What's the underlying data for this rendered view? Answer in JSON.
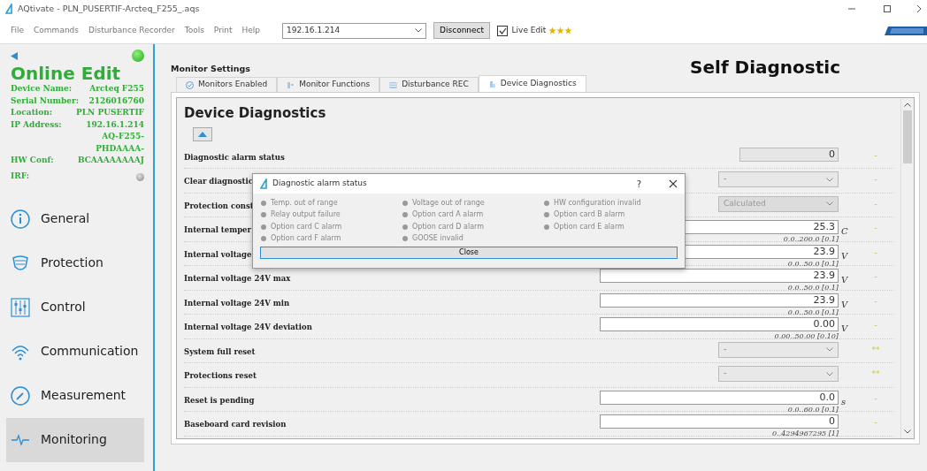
{
  "window": {
    "title": "AQtivate - PLN_PUSERTIF-Arcteq_F255_.aqs"
  },
  "menu": [
    "File",
    "Commands",
    "Disturbance Recorder",
    "Tools",
    "Print",
    "Help"
  ],
  "toolbar": {
    "address": "192.16.1.214",
    "disconnect": "Disconnect",
    "live_edit": {
      "label": "Live Edit",
      "checked": true
    },
    "stars": 3
  },
  "sidebar": {
    "online": true,
    "title": "Online Edit",
    "info": [
      {
        "label": "Device Name:",
        "value": "Arcteq F255"
      },
      {
        "label": "Serial Number:",
        "value": "2126016760"
      },
      {
        "label": "Location:",
        "value": "PLN PUSERTIF"
      },
      {
        "label": "IP Address:",
        "value": "192.16.1.214"
      },
      {
        "label": "HW Conf:",
        "value": "AQ-F255-PHDAAAA-BCAAAAAAAAJ"
      }
    ],
    "irf": {
      "label": "IRF:",
      "active": false
    },
    "items": [
      {
        "label": "General",
        "selected": false
      },
      {
        "label": "Protection",
        "selected": false
      },
      {
        "label": "Control",
        "selected": false
      },
      {
        "label": "Communication",
        "selected": false
      },
      {
        "label": "Measurement",
        "selected": false
      },
      {
        "label": "Monitoring",
        "selected": true
      }
    ]
  },
  "section": "Monitor Settings",
  "headline": "Self Diagnostic",
  "tabs": [
    {
      "label": "Monitors Enabled",
      "selected": false
    },
    {
      "label": "Monitor Functions",
      "selected": false
    },
    {
      "label": "Disturbance REC",
      "selected": false
    },
    {
      "label": "Device Diagnostics",
      "selected": true
    }
  ],
  "heading": "Device Diagnostics",
  "rows": [
    {
      "kind": "readonly",
      "label": "Diagnostic alarm status",
      "value": "0",
      "marker": "-"
    },
    {
      "kind": "select",
      "label": "Clear diagnostic",
      "value": "-",
      "marker": "-"
    },
    {
      "kind": "select_disabled",
      "label": "Protection const",
      "value": "Calculated",
      "marker": "-"
    },
    {
      "kind": "number",
      "label": "Internal temper",
      "value": "25.3",
      "unit": "C",
      "range": "0.0..200.0 [0.1]",
      "marker": "-"
    },
    {
      "kind": "number",
      "label": "Internal voltage",
      "value": "23.9",
      "unit": "V",
      "range": "0.0..50.0 [0.1]",
      "marker": "-"
    },
    {
      "kind": "number",
      "label": "Internal voltage 24V max",
      "value": "23.9",
      "unit": "V",
      "range": "0.0..50.0 [0.1]",
      "marker": "-"
    },
    {
      "kind": "number",
      "label": "Internal voltage 24V min",
      "value": "23.9",
      "unit": "V",
      "range": "0.0..50.0 [0.1]",
      "marker": "-"
    },
    {
      "kind": "number",
      "label": "Internal voltage 24V deviation",
      "value": "0.00",
      "unit": "V",
      "range": "0.00..50.00 [0.10]",
      "marker": "-"
    },
    {
      "kind": "select",
      "label": "System full reset",
      "value": "-",
      "marker": "**"
    },
    {
      "kind": "select",
      "label": "Protections reset",
      "value": "-",
      "marker": "**"
    },
    {
      "kind": "number",
      "label": "Reset is pending",
      "value": "0.0",
      "unit": "s",
      "range": "0.0..60.0 [0.1]",
      "marker": "-"
    },
    {
      "kind": "number",
      "label": "Baseboard card revision",
      "value": "0",
      "range": "0..4294967295 [1]",
      "marker": "-"
    }
  ],
  "dialog": {
    "title": "Diagnostic alarm status",
    "help": "?",
    "close": "Close",
    "alarms": [
      {
        "label": "Temp. out of range",
        "active": false
      },
      {
        "label": "Voltage out of range",
        "active": false
      },
      {
        "label": "HW configuration invalid",
        "active": false
      },
      {
        "label": "Relay output failure",
        "active": false
      },
      {
        "label": "Option card A alarm",
        "active": false
      },
      {
        "label": "Option card B alarm",
        "active": false
      },
      {
        "label": "Option card C alarm",
        "active": false
      },
      {
        "label": "Option card D alarm",
        "active": false
      },
      {
        "label": "Option card E alarm",
        "active": false
      },
      {
        "label": "Option card F alarm",
        "active": false
      },
      {
        "label": "GOOSE invalid",
        "active": false
      }
    ]
  }
}
